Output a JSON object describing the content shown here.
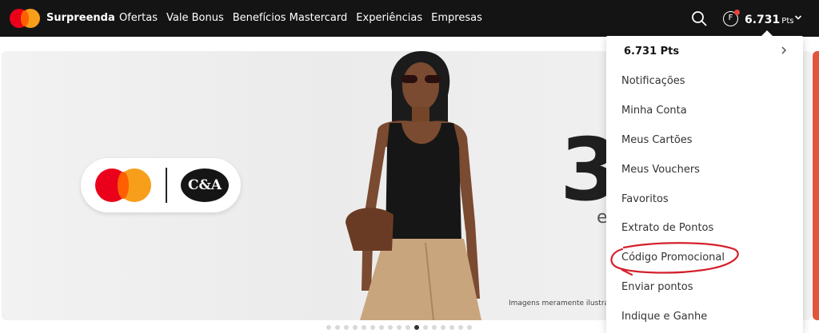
{
  "header": {
    "brand": "Surpreenda",
    "nav": [
      "Ofertas",
      "Vale Bonus",
      "Benefícios Mastercard",
      "Experiências",
      "Empresas"
    ],
    "avatar_letter": "F",
    "points_value": "6.731",
    "points_unit": "Pts"
  },
  "hero": {
    "partner_logo_text": "C&A",
    "headline_digit": "3",
    "headline_fragment": "e",
    "disclaimer": "Imagens meramente ilustrati"
  },
  "carousel": {
    "total": 17,
    "active_index": 10
  },
  "dropdown": {
    "points_label": "6.731 Pts",
    "items": [
      "Notificações",
      "Minha Conta",
      "Meus Cartões",
      "Meus Vouchers",
      "Favoritos",
      "Extrato de Pontos",
      "Código Promocional",
      "Enviar pontos",
      "Indique e Ganhe"
    ],
    "highlighted_item": "Código Promocional"
  },
  "colors": {
    "topbar": "#141414",
    "mastercard_red": "#eb001b",
    "mastercard_yellow": "#f79e1b",
    "highlight_circle": "#d4202c",
    "notification_dot": "#e8413a"
  },
  "icons": [
    "mastercard-logo-icon",
    "search-icon",
    "chevron-down-icon",
    "chevron-right-icon"
  ]
}
